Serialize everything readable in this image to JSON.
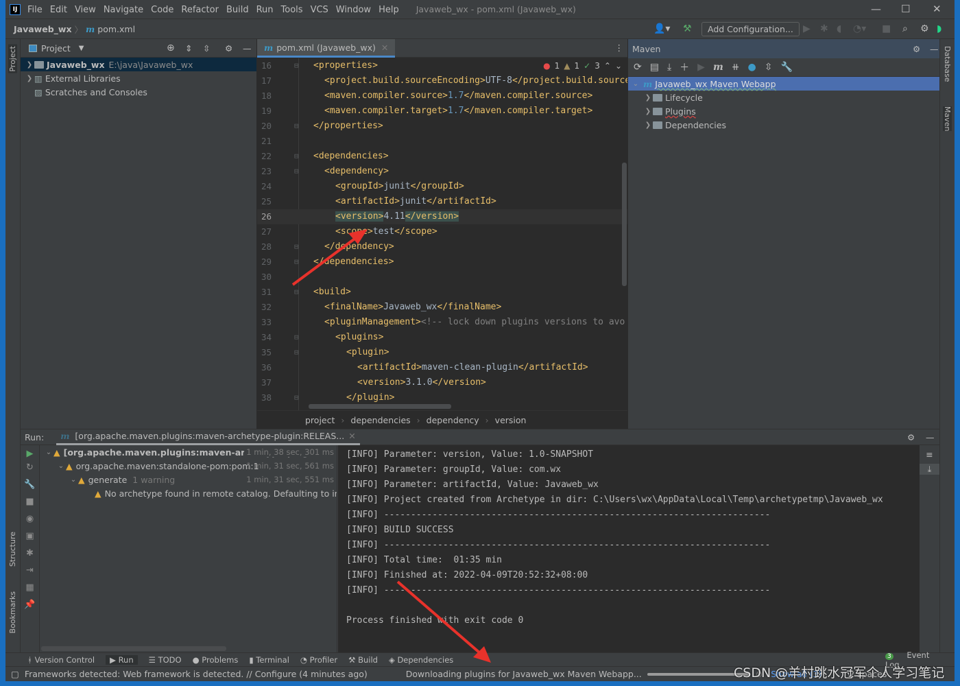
{
  "titlebar": {
    "logo": "IJ",
    "menu": [
      "File",
      "Edit",
      "View",
      "Navigate",
      "Code",
      "Refactor",
      "Build",
      "Run",
      "Tools",
      "VCS",
      "Window",
      "Help"
    ],
    "title": "Javaweb_wx - pom.xml (Javaweb_wx)"
  },
  "navbar": {
    "project": "Javaweb_wx",
    "file_icon": "m",
    "file": "pom.xml",
    "add_config": "Add Configuration..."
  },
  "leftstrip": {
    "project": "Project",
    "structure": "Structure",
    "bookmarks": "Bookmarks"
  },
  "project_panel": {
    "title": "Project",
    "items": [
      {
        "label": "Javaweb_wx",
        "path": "E:\\java\\Javaweb_wx",
        "selected": true
      },
      {
        "label": "External Libraries"
      },
      {
        "label": "Scratches and Consoles"
      }
    ]
  },
  "editor": {
    "tab": "pom.xml (Javaweb_wx)",
    "inspections": {
      "errors": "1",
      "warnings": "1",
      "typos": "3"
    },
    "current_line": 26,
    "lines": [
      {
        "n": 16,
        "i": 0,
        "p": [
          [
            "t",
            "<properties>"
          ]
        ]
      },
      {
        "n": 17,
        "i": 1,
        "p": [
          [
            "t",
            "<project.build.sourceEncoding>"
          ],
          [
            "x",
            "UTF-8"
          ],
          [
            "t",
            "</project.build.sourceEncoding>"
          ]
        ]
      },
      {
        "n": 18,
        "i": 1,
        "p": [
          [
            "t",
            "<maven.compiler.source>"
          ],
          [
            "n",
            "1.7"
          ],
          [
            "t",
            "</maven.compiler.source>"
          ]
        ]
      },
      {
        "n": 19,
        "i": 1,
        "p": [
          [
            "t",
            "<maven.compiler.target>"
          ],
          [
            "n",
            "1.7"
          ],
          [
            "t",
            "</maven.compiler.target>"
          ]
        ]
      },
      {
        "n": 20,
        "i": 0,
        "p": [
          [
            "t",
            "</properties>"
          ]
        ]
      },
      {
        "n": 21,
        "i": 0,
        "p": []
      },
      {
        "n": 22,
        "i": 0,
        "p": [
          [
            "t",
            "<dependencies>"
          ]
        ]
      },
      {
        "n": 23,
        "i": 1,
        "p": [
          [
            "t",
            "<dependency>"
          ]
        ]
      },
      {
        "n": 24,
        "i": 2,
        "p": [
          [
            "t",
            "<groupId>"
          ],
          [
            "x",
            "junit"
          ],
          [
            "t",
            "</groupId>"
          ]
        ]
      },
      {
        "n": 25,
        "i": 2,
        "p": [
          [
            "t",
            "<artifactId>"
          ],
          [
            "x",
            "junit"
          ],
          [
            "t",
            "</artifactId>"
          ]
        ]
      },
      {
        "n": 26,
        "i": 2,
        "p": [
          [
            "th",
            "<version>"
          ],
          [
            "x",
            "4.11"
          ],
          [
            "th",
            "</version>"
          ]
        ]
      },
      {
        "n": 27,
        "i": 2,
        "p": [
          [
            "t",
            "<scope>"
          ],
          [
            "x",
            "test"
          ],
          [
            "t",
            "</scope>"
          ]
        ]
      },
      {
        "n": 28,
        "i": 1,
        "p": [
          [
            "t",
            "</dependency>"
          ]
        ]
      },
      {
        "n": 29,
        "i": 0,
        "p": [
          [
            "t",
            "</dependencies>"
          ]
        ]
      },
      {
        "n": 30,
        "i": 0,
        "p": []
      },
      {
        "n": 31,
        "i": 0,
        "p": [
          [
            "t",
            "<build>"
          ]
        ]
      },
      {
        "n": 32,
        "i": 1,
        "p": [
          [
            "t",
            "<finalName>"
          ],
          [
            "x",
            "Javaweb_wx"
          ],
          [
            "t",
            "</finalName>"
          ]
        ]
      },
      {
        "n": 33,
        "i": 1,
        "p": [
          [
            "t",
            "<pluginManagement>"
          ],
          [
            "c",
            "<!-- lock down plugins versions to avo"
          ]
        ]
      },
      {
        "n": 34,
        "i": 2,
        "p": [
          [
            "t",
            "<plugins>"
          ]
        ]
      },
      {
        "n": 35,
        "i": 3,
        "p": [
          [
            "t",
            "<plugin>"
          ]
        ]
      },
      {
        "n": 36,
        "i": 4,
        "p": [
          [
            "t",
            "<artifactId>"
          ],
          [
            "x",
            "maven-clean-plugin"
          ],
          [
            "t",
            "</artifactId>"
          ]
        ]
      },
      {
        "n": 37,
        "i": 4,
        "p": [
          [
            "t",
            "<version>"
          ],
          [
            "x",
            "3.1.0"
          ],
          [
            "t",
            "</version>"
          ]
        ]
      },
      {
        "n": 38,
        "i": 3,
        "p": [
          [
            "t",
            "</plugin>"
          ]
        ]
      }
    ],
    "breadcrumb": [
      "project",
      "dependencies",
      "dependency",
      "version"
    ]
  },
  "maven": {
    "title": "Maven",
    "root": "Javaweb_wx Maven Webapp",
    "children": [
      "Lifecycle",
      "Plugins",
      "Dependencies"
    ]
  },
  "rightstrip": {
    "database": "Database",
    "maven": "Maven"
  },
  "run": {
    "label": "Run:",
    "tab": "[org.apache.maven.plugins:maven-archetype-plugin:RELEAS...",
    "tree": [
      {
        "label": "[org.apache.maven.plugins:maven-archetype-plugin",
        "time": "1 min, 38 sec, 301 ms"
      },
      {
        "label": "org.apache.maven:standalone-pom:pom:1",
        "time": "1 min, 31 sec, 561 ms"
      },
      {
        "label": "generate",
        "note": "1 warning",
        "time": "1 min, 31 sec, 551 ms"
      },
      {
        "label": "No archetype found in remote catalog. Defaulting to internal catalog"
      }
    ],
    "console": [
      "[INFO] Parameter: version, Value: 1.0-SNAPSHOT",
      "[INFO] Parameter: groupId, Value: com.wx",
      "[INFO] Parameter: artifactId, Value: Javaweb_wx",
      "[INFO] Project created from Archetype in dir: C:\\Users\\wx\\AppData\\Local\\Temp\\archetypetmp\\Javaweb_wx",
      "[INFO] ------------------------------------------------------------------------",
      "[INFO] BUILD SUCCESS",
      "[INFO] ------------------------------------------------------------------------",
      "[INFO] Total time:  01:35 min",
      "[INFO] Finished at: 2022-04-09T20:52:32+08:00",
      "[INFO] ------------------------------------------------------------------------",
      "",
      "Process finished with exit code 0"
    ]
  },
  "bottom_tabs": [
    "Version Control",
    "Run",
    "TODO",
    "Problems",
    "Terminal",
    "Profiler",
    "Build",
    "Dependencies"
  ],
  "event_log": {
    "count": "3",
    "label": "Event Log"
  },
  "status": {
    "message": "Frameworks detected: Web framework is detected. // Configure (4 minutes ago)",
    "progress_text": "Downloading plugins for Javaweb_wx Maven Webapp...",
    "show_all": "Show all (3)",
    "indent": "2 spaces"
  },
  "watermark": "CSDN @羊村跳水冠军个人学习笔记",
  "colors": {
    "accent": "#4b6eaf",
    "tag": "#e8bf6a",
    "annotation_arrow": "#e8322b"
  }
}
